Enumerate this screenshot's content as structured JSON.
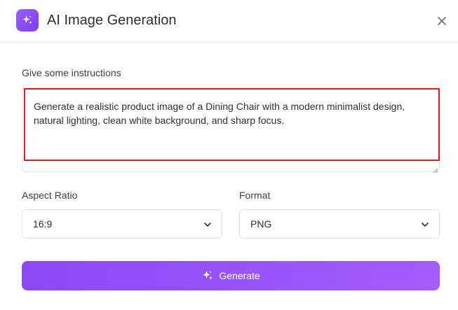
{
  "header": {
    "title": "AI Image Generation",
    "logo_icon": "sparkle-icon",
    "close_icon": "close-icon",
    "brand_color": "#8b4ff5"
  },
  "instructions": {
    "label": "Give some instructions",
    "value": "Generate a realistic product image of a Dining Chair with a modern minimalist design, natural lighting, clean white background, and sharp focus.",
    "highlight_color": "#e01b1b"
  },
  "aspect_ratio": {
    "label": "Aspect Ratio",
    "selected": "16:9"
  },
  "format": {
    "label": "Format",
    "selected": "PNG"
  },
  "generate_button": {
    "label": "Generate",
    "icon": "sparkle-icon"
  }
}
